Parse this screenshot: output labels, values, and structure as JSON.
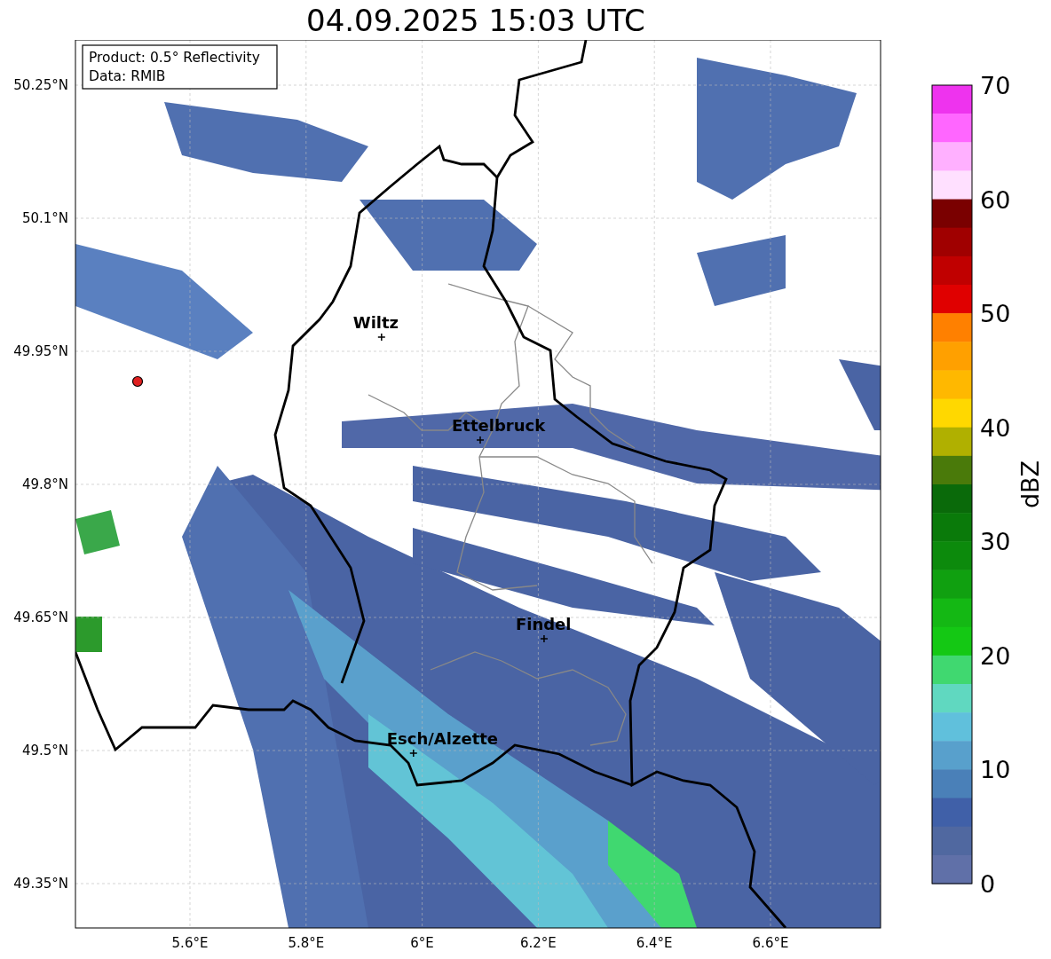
{
  "title": "04.09.2025 15:03 UTC",
  "info_box": {
    "lines": [
      "Product: 0.5° Reflectivity",
      "Data: RMIB"
    ]
  },
  "map": {
    "x_ticks": [
      "5.6°E",
      "5.8°E",
      "6°E",
      "6.2°E",
      "6.4°E",
      "6.6°E"
    ],
    "y_ticks": [
      "50.25°N",
      "50.1°N",
      "49.95°N",
      "49.8°N",
      "49.65°N",
      "49.5°N",
      "49.35°N"
    ],
    "places": [
      {
        "label": "Wiltz"
      },
      {
        "label": "Ettelbruck"
      },
      {
        "label": "Findel"
      },
      {
        "label": "Esch/Alzette"
      }
    ]
  },
  "colorbar": {
    "label": "dBZ",
    "ticks": [
      "70",
      "60",
      "50",
      "40",
      "30",
      "20",
      "10",
      "0"
    ],
    "segments": [
      {
        "color": "#ee33ee"
      },
      {
        "color": "#ff66ff"
      },
      {
        "color": "#ffb0ff"
      },
      {
        "color": "#ffe0ff"
      },
      {
        "color": "#7a0000"
      },
      {
        "color": "#a00000"
      },
      {
        "color": "#c00000"
      },
      {
        "color": "#e00000"
      },
      {
        "color": "#ff8000"
      },
      {
        "color": "#ffa000"
      },
      {
        "color": "#ffb800"
      },
      {
        "color": "#ffd800"
      },
      {
        "color": "#b0b000"
      },
      {
        "color": "#4a7a0a"
      },
      {
        "color": "#0a6a0a"
      },
      {
        "color": "#0a7a0a"
      },
      {
        "color": "#0c8a0c"
      },
      {
        "color": "#10a010"
      },
      {
        "color": "#14b814"
      },
      {
        "color": "#14c814"
      },
      {
        "color": "#40d870"
      },
      {
        "color": "#60d8c0"
      },
      {
        "color": "#60c0dc"
      },
      {
        "color": "#58a0cc"
      },
      {
        "color": "#4a80b8"
      },
      {
        "color": "#4060a8"
      },
      {
        "color": "#5068a0"
      },
      {
        "color": "#6070a8"
      }
    ]
  }
}
